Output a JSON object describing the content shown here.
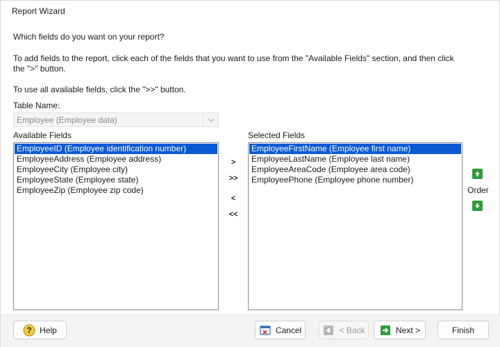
{
  "window": {
    "title": "Report Wizard"
  },
  "intro": {
    "question": "Which fields do you want on your report?",
    "instruction_line1": "To add fields to the report, click each of the fields that you want to use from the \"Available Fields\" section, and then click",
    "instruction_line2": "the \">\" button.",
    "instruction_all": "To use all available fields, click the \">>\" button."
  },
  "table": {
    "label": "Table Name:",
    "value": "Employee  (Employee data)"
  },
  "available": {
    "label": "Available Fields",
    "items": [
      "EmployeeID  (Employee identification number)",
      "EmployeeAddress  (Employee address)",
      "EmployeeCity  (Employee city)",
      "EmployeeState  (Employee state)",
      "EmployeeZip  (Employee zip code)"
    ]
  },
  "selected": {
    "label": "Selected Fields",
    "items": [
      "EmployeeFirstName  (Employee first name)",
      "EmployeeLastName  (Employee last name)",
      "EmployeeAreaCode  (Employee area code)",
      "EmployeePhone  (Employee phone number)"
    ]
  },
  "move_buttons": {
    "add": ">",
    "add_all": ">>",
    "remove": "<",
    "remove_all": "<<"
  },
  "order": {
    "label": "Order"
  },
  "footer": {
    "help": "Help",
    "cancel": "Cancel",
    "back": "< Back",
    "next": "Next >",
    "finish": "Finish"
  },
  "colors": {
    "selection": "#0a5ad4",
    "order_arrows": "#2e9c3a"
  },
  "icons": {
    "help": "help-icon",
    "cancel": "cancel-icon",
    "back": "back-arrow-icon",
    "next": "next-arrow-icon",
    "order_up": "arrow-up-icon",
    "order_down": "arrow-down-icon",
    "combo": "chevron-down-icon"
  }
}
